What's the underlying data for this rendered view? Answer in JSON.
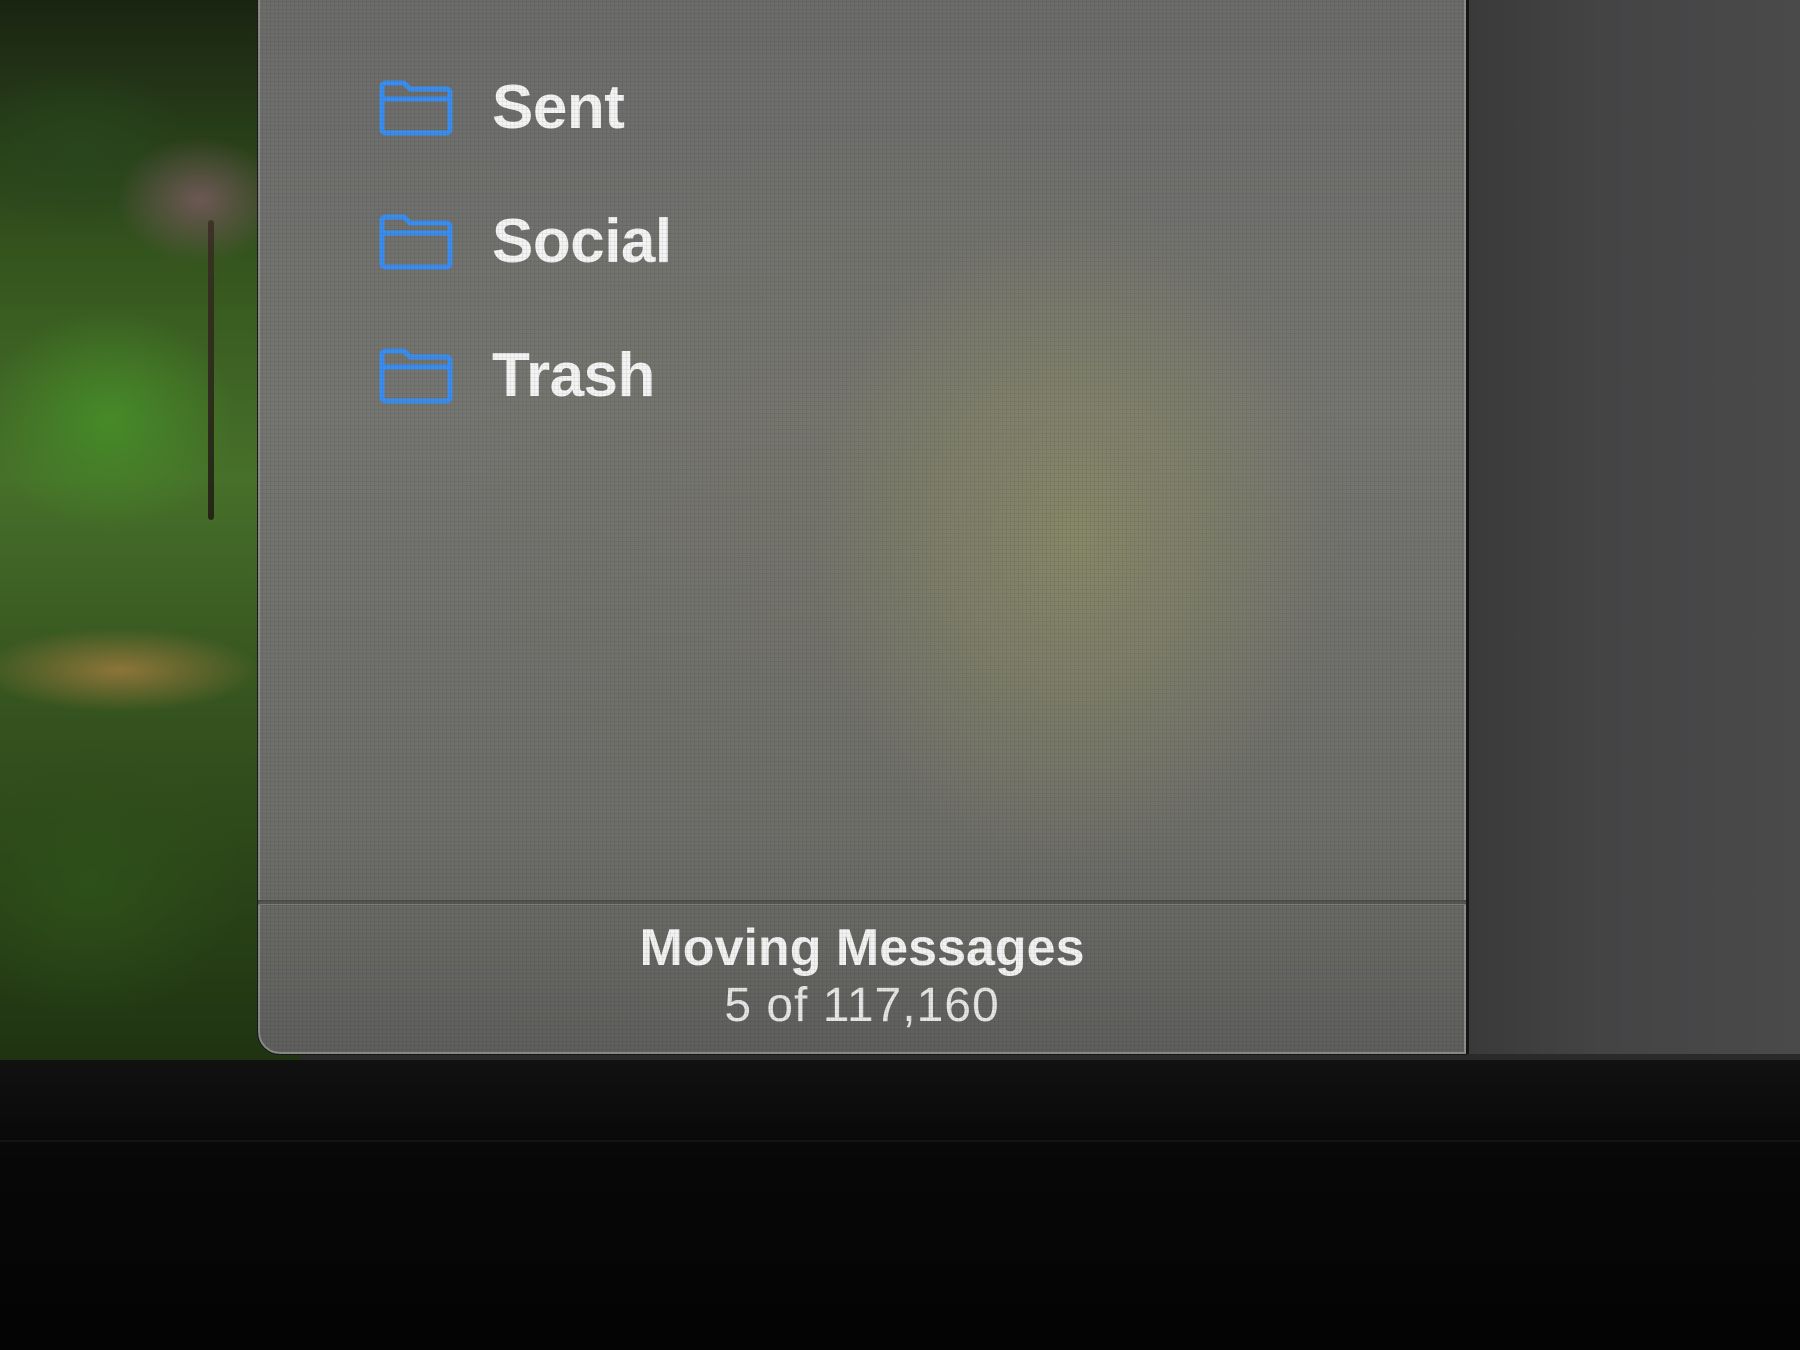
{
  "mailboxes": {
    "items": [
      {
        "label": "Sent",
        "icon": "folder-icon"
      },
      {
        "label": "Social",
        "icon": "folder-icon"
      },
      {
        "label": "Trash",
        "icon": "folder-icon"
      }
    ]
  },
  "status": {
    "title": "Moving Messages",
    "progress": "5 of 117,160"
  },
  "colors": {
    "accent": "#3a8ef0",
    "panel_background": "#6e6e6b",
    "text": "#f4f4f4"
  }
}
